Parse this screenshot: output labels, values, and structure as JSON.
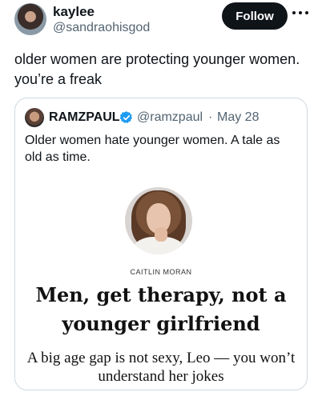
{
  "post": {
    "author_name": "kaylee",
    "author_handle": "@sandraohisgod",
    "follow_label": "Follow",
    "more_icon": "more-horizontal-icon",
    "text": "older women are protecting younger women. you’re a freak"
  },
  "quote": {
    "author_name": "RAMZPAUL",
    "verified_icon": "verified-badge-icon",
    "verified_color": "#1d9bf0",
    "author_handle": "@ramzpaul",
    "separator": "·",
    "date": "May 28",
    "text": "Older women hate younger women. A tale as old as time.",
    "article": {
      "author": "CAITLIN MORAN",
      "headline": "Men, get therapy, not a younger girlfriend",
      "standfirst": "A big age gap is not sexy, Leo — you won’t understand her jokes"
    }
  }
}
